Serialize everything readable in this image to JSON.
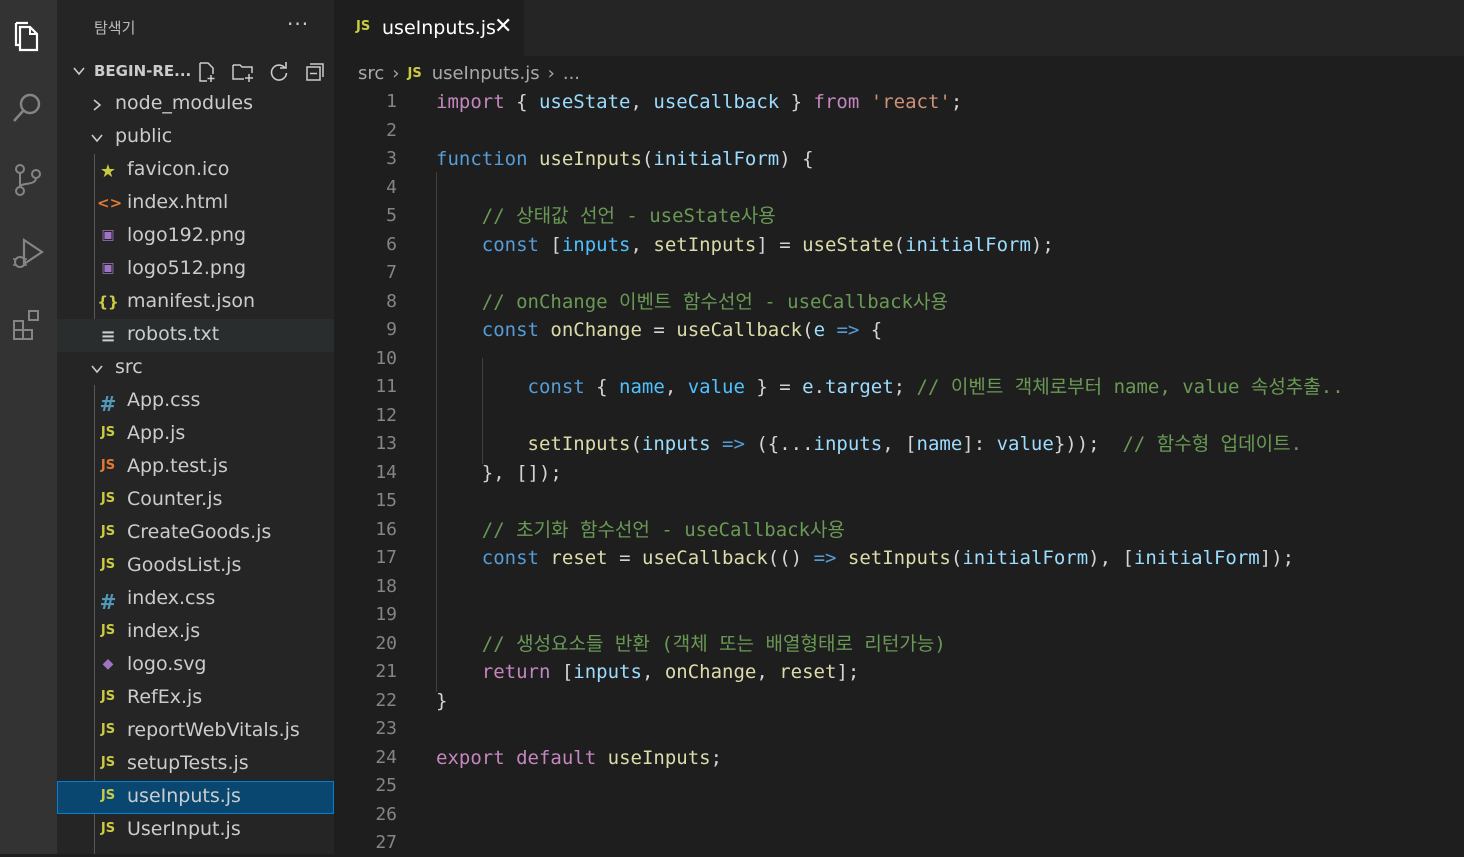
{
  "sidebar": {
    "title": "탐색기",
    "more": "···",
    "root": "BEGIN-RE...",
    "items": [
      {
        "label": "node_modules",
        "type": "folder",
        "state": "collapsed",
        "depth": 0
      },
      {
        "label": "public",
        "type": "folder",
        "state": "expanded",
        "depth": 0
      },
      {
        "label": "favicon.ico",
        "type": "file",
        "icon": "★",
        "icon_name": "star-icon",
        "depth": 1
      },
      {
        "label": "index.html",
        "type": "file",
        "icon": "<>",
        "icon_name": "html-icon",
        "depth": 1
      },
      {
        "label": "logo192.png",
        "type": "file",
        "icon": "▣",
        "icon_name": "image-icon",
        "depth": 1
      },
      {
        "label": "logo512.png",
        "type": "file",
        "icon": "▣",
        "icon_name": "image-icon",
        "depth": 1
      },
      {
        "label": "manifest.json",
        "type": "file",
        "icon": "{}",
        "icon_name": "json-icon",
        "depth": 1
      },
      {
        "label": "robots.txt",
        "type": "file",
        "icon": "≡",
        "icon_name": "text-icon",
        "depth": 1
      },
      {
        "label": "src",
        "type": "folder",
        "state": "expanded",
        "depth": 0
      },
      {
        "label": "App.css",
        "type": "file",
        "icon": "#",
        "icon_name": "css-icon",
        "depth": 1
      },
      {
        "label": "App.js",
        "type": "file",
        "icon": "JS",
        "icon_name": "js-icon",
        "depth": 1
      },
      {
        "label": "App.test.js",
        "type": "file",
        "icon": "JS",
        "icon_name": "js-test-icon",
        "depth": 1
      },
      {
        "label": "Counter.js",
        "type": "file",
        "icon": "JS",
        "icon_name": "js-icon",
        "depth": 1
      },
      {
        "label": "CreateGoods.js",
        "type": "file",
        "icon": "JS",
        "icon_name": "js-icon",
        "depth": 1
      },
      {
        "label": "GoodsList.js",
        "type": "file",
        "icon": "JS",
        "icon_name": "js-icon",
        "depth": 1
      },
      {
        "label": "index.css",
        "type": "file",
        "icon": "#",
        "icon_name": "css-icon",
        "depth": 1
      },
      {
        "label": "index.js",
        "type": "file",
        "icon": "JS",
        "icon_name": "js-icon",
        "depth": 1
      },
      {
        "label": "logo.svg",
        "type": "file",
        "icon": "◆",
        "icon_name": "svg-icon",
        "depth": 1
      },
      {
        "label": "RefEx.js",
        "type": "file",
        "icon": "JS",
        "icon_name": "js-icon",
        "depth": 1
      },
      {
        "label": "reportWebVitals.js",
        "type": "file",
        "icon": "JS",
        "icon_name": "js-icon",
        "depth": 1
      },
      {
        "label": "setupTests.js",
        "type": "file",
        "icon": "JS",
        "icon_name": "js-icon",
        "depth": 1
      },
      {
        "label": "useInputs.js",
        "type": "file",
        "icon": "JS",
        "icon_name": "js-icon",
        "depth": 1,
        "selected": true
      },
      {
        "label": "UserInput.js",
        "type": "file",
        "icon": "JS",
        "icon_name": "js-icon",
        "depth": 1
      }
    ]
  },
  "tab": {
    "icon": "JS",
    "label": "useInputs.js",
    "close": "✕"
  },
  "breadcrumb": {
    "folder": "src",
    "js": "JS",
    "file": "useInputs.js",
    "more": "..."
  },
  "editor": {
    "lines": [
      {
        "n": "1",
        "tokens": [
          [
            "ctl",
            "import"
          ],
          [
            "pun",
            " { "
          ],
          [
            "var",
            "useState"
          ],
          [
            "pun",
            ", "
          ],
          [
            "var",
            "useCallback"
          ],
          [
            "pun",
            " } "
          ],
          [
            "ctl",
            "from"
          ],
          [
            "pun",
            " "
          ],
          [
            "str",
            "'react'"
          ],
          [
            "pun",
            ";"
          ]
        ]
      },
      {
        "n": "2",
        "tokens": []
      },
      {
        "n": "3",
        "tokens": [
          [
            "kw",
            "function"
          ],
          [
            "pun",
            " "
          ],
          [
            "fn",
            "useInputs"
          ],
          [
            "pun",
            "("
          ],
          [
            "var",
            "initialForm"
          ],
          [
            "pun",
            ") {"
          ]
        ]
      },
      {
        "n": "4",
        "tokens": []
      },
      {
        "n": "5",
        "tokens": [
          [
            "pun",
            "    "
          ],
          [
            "cm",
            "// 상태값 선언 - useState사용"
          ]
        ]
      },
      {
        "n": "6",
        "tokens": [
          [
            "pun",
            "    "
          ],
          [
            "kw",
            "const"
          ],
          [
            "pun",
            " ["
          ],
          [
            "cv",
            "inputs"
          ],
          [
            "pun",
            ", "
          ],
          [
            "fn",
            "setInputs"
          ],
          [
            "pun",
            "] = "
          ],
          [
            "fn",
            "useState"
          ],
          [
            "pun",
            "("
          ],
          [
            "var",
            "initialForm"
          ],
          [
            "pun",
            ");"
          ]
        ]
      },
      {
        "n": "7",
        "tokens": []
      },
      {
        "n": "8",
        "tokens": [
          [
            "pun",
            "    "
          ],
          [
            "cm",
            "// onChange 이벤트 함수선언 - useCallback사용"
          ]
        ]
      },
      {
        "n": "9",
        "tokens": [
          [
            "pun",
            "    "
          ],
          [
            "kw",
            "const"
          ],
          [
            "pun",
            " "
          ],
          [
            "fn",
            "onChange"
          ],
          [
            "pun",
            " = "
          ],
          [
            "fn",
            "useCallback"
          ],
          [
            "pun",
            "("
          ],
          [
            "var",
            "e"
          ],
          [
            "pun",
            " "
          ],
          [
            "kw",
            "=>"
          ],
          [
            "pun",
            " {"
          ]
        ]
      },
      {
        "n": "10",
        "tokens": []
      },
      {
        "n": "11",
        "tokens": [
          [
            "pun",
            "        "
          ],
          [
            "kw",
            "const"
          ],
          [
            "pun",
            " { "
          ],
          [
            "cv",
            "name"
          ],
          [
            "pun",
            ", "
          ],
          [
            "cv",
            "value"
          ],
          [
            "pun",
            " } = "
          ],
          [
            "var",
            "e"
          ],
          [
            "pun",
            "."
          ],
          [
            "var",
            "target"
          ],
          [
            "pun",
            "; "
          ],
          [
            "cm",
            "// 이벤트 객체로부터 name, value 속성추출.."
          ]
        ]
      },
      {
        "n": "12",
        "tokens": []
      },
      {
        "n": "13",
        "tokens": [
          [
            "pun",
            "        "
          ],
          [
            "fn",
            "setInputs"
          ],
          [
            "pun",
            "("
          ],
          [
            "var",
            "inputs"
          ],
          [
            "pun",
            " "
          ],
          [
            "kw",
            "=>"
          ],
          [
            "pun",
            " ({..."
          ],
          [
            "var",
            "inputs"
          ],
          [
            "pun",
            ", ["
          ],
          [
            "var",
            "name"
          ],
          [
            "pun",
            "]: "
          ],
          [
            "var",
            "value"
          ],
          [
            "pun",
            "}));  "
          ],
          [
            "cm",
            "// 함수형 업데이트."
          ]
        ]
      },
      {
        "n": "14",
        "tokens": [
          [
            "pun",
            "    }, []);"
          ]
        ]
      },
      {
        "n": "15",
        "tokens": []
      },
      {
        "n": "16",
        "tokens": [
          [
            "pun",
            "    "
          ],
          [
            "cm",
            "// 초기화 함수선언 - useCallback사용"
          ]
        ]
      },
      {
        "n": "17",
        "tokens": [
          [
            "pun",
            "    "
          ],
          [
            "kw",
            "const"
          ],
          [
            "pun",
            " "
          ],
          [
            "fn",
            "reset"
          ],
          [
            "pun",
            " = "
          ],
          [
            "fn",
            "useCallback"
          ],
          [
            "pun",
            "(() "
          ],
          [
            "kw",
            "=>"
          ],
          [
            "pun",
            " "
          ],
          [
            "fn",
            "setInputs"
          ],
          [
            "pun",
            "("
          ],
          [
            "var",
            "initialForm"
          ],
          [
            "pun",
            "), ["
          ],
          [
            "var",
            "initialForm"
          ],
          [
            "pun",
            "]);"
          ]
        ]
      },
      {
        "n": "18",
        "tokens": []
      },
      {
        "n": "19",
        "tokens": []
      },
      {
        "n": "20",
        "tokens": [
          [
            "pun",
            "    "
          ],
          [
            "cm",
            "// 생성요소들 반환 (객체 또는 배열형태로 리턴가능)"
          ]
        ]
      },
      {
        "n": "21",
        "tokens": [
          [
            "pun",
            "    "
          ],
          [
            "ctl",
            "return"
          ],
          [
            "pun",
            " ["
          ],
          [
            "var",
            "inputs"
          ],
          [
            "pun",
            ", "
          ],
          [
            "fn",
            "onChange"
          ],
          [
            "pun",
            ", "
          ],
          [
            "fn",
            "reset"
          ],
          [
            "pun",
            "];"
          ]
        ]
      },
      {
        "n": "22",
        "tokens": [
          [
            "pun",
            "}"
          ]
        ]
      },
      {
        "n": "23",
        "tokens": []
      },
      {
        "n": "24",
        "tokens": [
          [
            "ctl",
            "export"
          ],
          [
            "pun",
            " "
          ],
          [
            "ctl",
            "default"
          ],
          [
            "pun",
            " "
          ],
          [
            "fn",
            "useInputs"
          ],
          [
            "pun",
            ";"
          ]
        ]
      },
      {
        "n": "25",
        "tokens": []
      },
      {
        "n": "26",
        "tokens": []
      },
      {
        "n": "27",
        "tokens": []
      }
    ]
  },
  "colors": {
    "activity_bar": "#333333",
    "sidebar": "#252526",
    "editor": "#1e1e1e",
    "selection": "#094771"
  }
}
